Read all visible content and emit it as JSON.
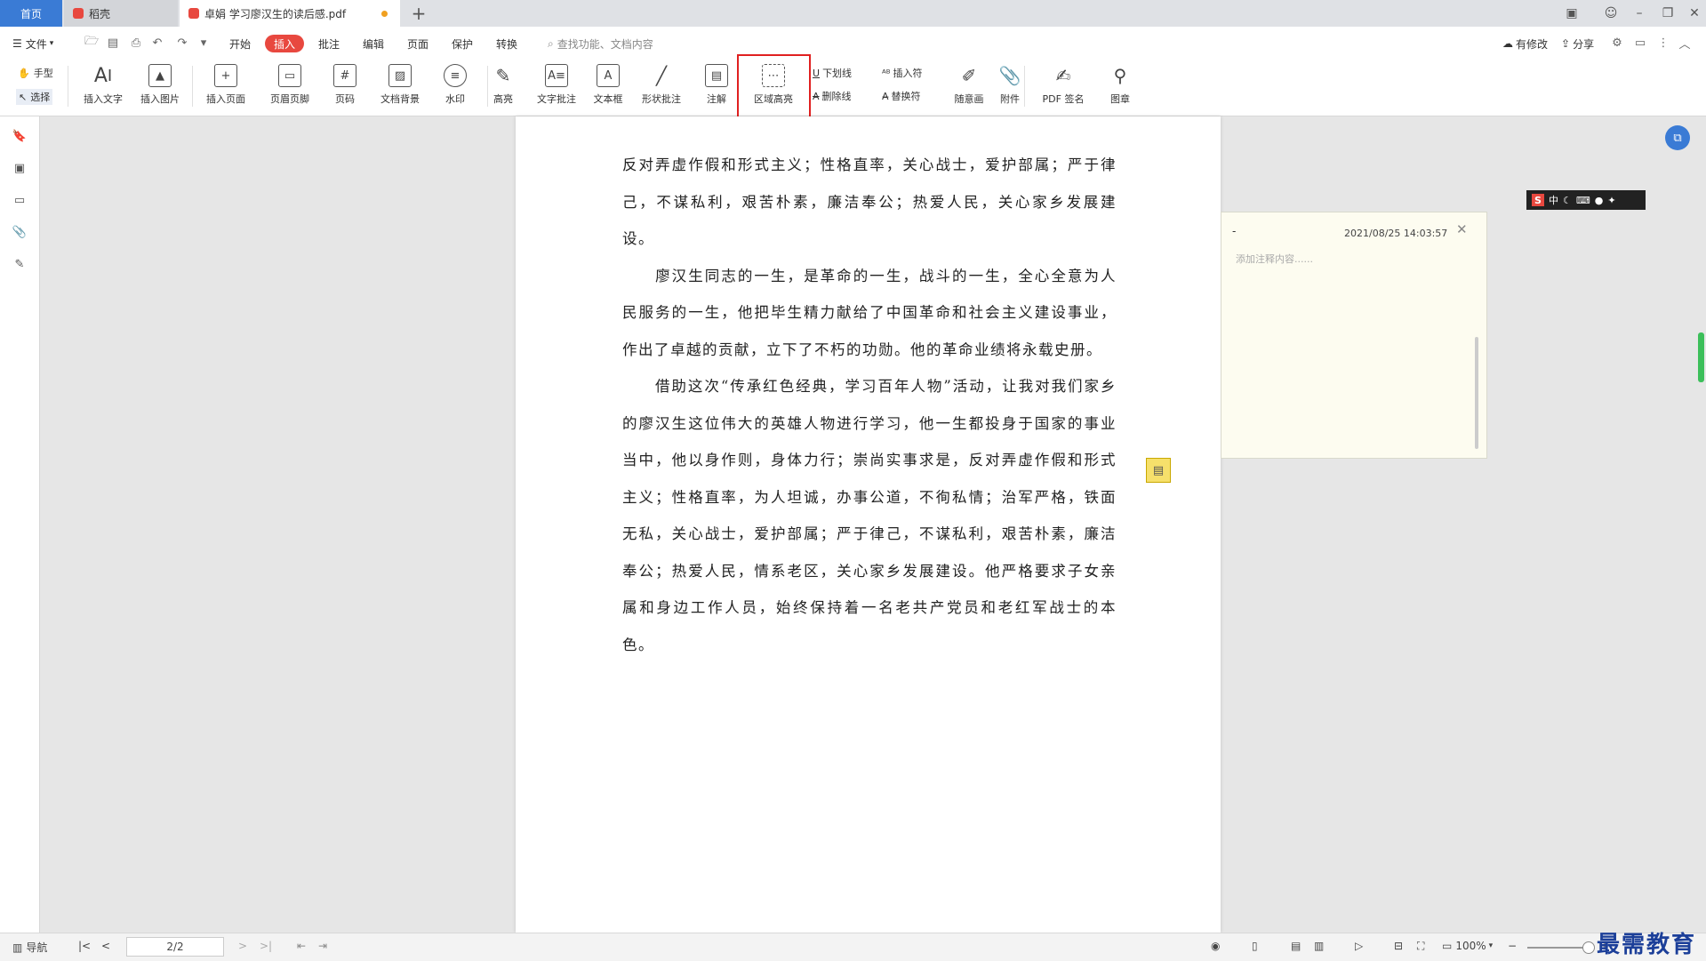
{
  "tabs": [
    {
      "label": "首页"
    },
    {
      "label": "稻壳"
    },
    {
      "label": "卓娟 学习廖汉生的读后感.pdf"
    }
  ],
  "new_tab": "+",
  "menu": {
    "file": "文件",
    "items": [
      "开始",
      "插入",
      "批注",
      "编辑",
      "页面",
      "保护",
      "转换"
    ],
    "search_placeholder": "查找功能、文档内容",
    "modified": "有修改",
    "share": "分享"
  },
  "toolbar": {
    "hand": "手型",
    "select": "选择",
    "insert_text": "插入文字",
    "insert_image": "插入图片",
    "insert_page": "插入页面",
    "header_footer": "页眉页脚",
    "page_number": "页码",
    "doc_background": "文档背景",
    "watermark": "水印",
    "highlight": "高亮",
    "text_comment": "文字批注",
    "text_box": "文本框",
    "shape_comment": "形状批注",
    "annotation": "注解",
    "area_highlight": "区域高亮",
    "underline": "下划线",
    "strikethrough": "删除线",
    "insert_mark": "插入符",
    "replace_mark": "替换符",
    "freehand": "随意画",
    "attachment": "附件",
    "pdf_sign": "PDF 签名",
    "stamp": "图章"
  },
  "document": {
    "paragraphs": [
      "反对弄虚作假和形式主义；性格直率，关心战士，爱护部属；严于律己，不谋私利，艰苦朴素，廉洁奉公；热爱人民，关心家乡发展建设。",
      "　　廖汉生同志的一生，是革命的一生，战斗的一生，全心全意为人民服务的一生，他把毕生精力献给了中国革命和社会主义建设事业，作出了卓越的贡献，立下了不朽的功勋。他的革命业绩将永载史册。",
      "　　借助这次“传承红色经典，学习百年人物”活动，让我对我们家乡的廖汉生这位伟大的英雄人物进行学习，他一生都投身于国家的事业当中，他以身作则，身体力行；崇尚实事求是，反对弄虚作假和形式主义；性格直率，为人坦诚，办事公道，不徇私情；治军严格，铁面无私，关心战士，爱护部属；严于律己，不谋私利，艰苦朴素，廉洁奉公；热爱人民，情系老区，关心家乡发展建设。他严格要求子女亲属和身边工作人员，始终保持着一名老共产党员和老红军战士的本色。"
    ]
  },
  "comment": {
    "author": "-",
    "timestamp": "2021/08/25 14:03:57",
    "placeholder": "添加注释内容......"
  },
  "ime": {
    "chars": "中"
  },
  "statusbar": {
    "nav": "导航",
    "page": "2/2",
    "zoom": "100%"
  },
  "watermark_brand": "最需教育",
  "colors": {
    "accent": "#e8483f",
    "home_tab": "#3a7bd5",
    "highlight_frame": "#e02020",
    "note_bg": "#fdfcf0"
  }
}
